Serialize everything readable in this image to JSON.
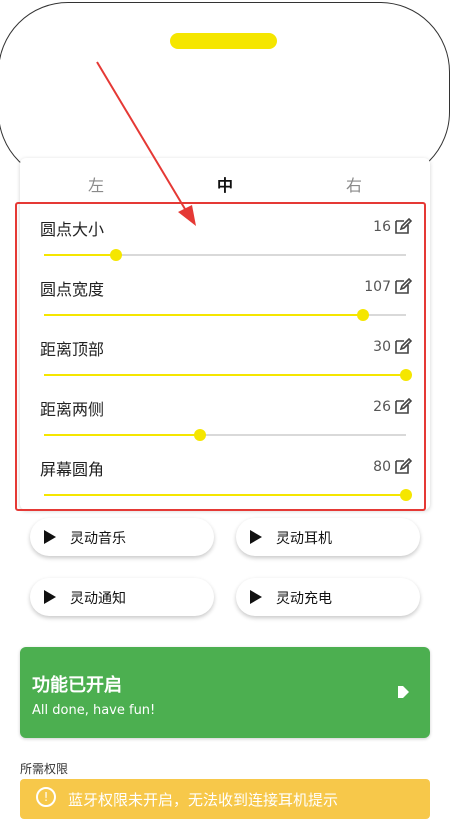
{
  "tabs": [
    "左",
    "中",
    "右"
  ],
  "active_tab": "中",
  "sliders": [
    {
      "label": "圆点大小",
      "value": "16",
      "level": 0.2
    },
    {
      "label": "圆点宽度",
      "value": "107",
      "level": 0.88
    },
    {
      "label": "距离顶部",
      "value": "30",
      "level": 1.0
    },
    {
      "label": "距离两侧",
      "value": "26",
      "level": 0.43
    },
    {
      "label": "屏幕圆角",
      "value": "80",
      "level": 1.0
    }
  ],
  "buttons": [
    "灵动音乐",
    "灵动耳机",
    "灵动通知",
    "灵动充电"
  ],
  "status": {
    "title": "功能已开启",
    "subtitle": "All done, have fun!"
  },
  "permissions_title": "所需权限",
  "warning_text": "蓝牙权限未开启，无法收到连接耳机提示",
  "colors": {
    "accent": "#f5e600",
    "success": "#4caf50",
    "warning": "#f7c84a",
    "annotation": "#e53935"
  }
}
